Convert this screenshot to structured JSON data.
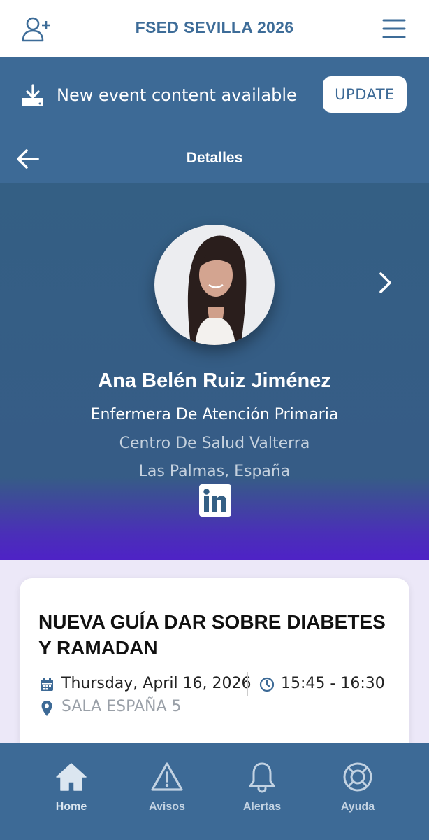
{
  "header": {
    "title": "FSED SEVILLA 2026",
    "add_user_icon": "add-user-icon",
    "menu_icon": "hamburger-menu-icon"
  },
  "banner": {
    "message": "New event content available",
    "update_label": "UPDATE",
    "icon": "download-icon"
  },
  "nav": {
    "title": "Detalles",
    "back_icon": "arrow-left-icon"
  },
  "speaker": {
    "name": "Ana Belén Ruiz Jiménez",
    "role": "Enfermera De Atención Primaria",
    "center": "Centro De Salud Valterra",
    "location": "Las Palmas, España",
    "linkedin_label": "in",
    "next_icon": "chevron-right-icon"
  },
  "session": {
    "title": "NUEVA GUÍA DAR SOBRE DIABETES Y RAMADAN",
    "date": "Thursday, April 16, 2026",
    "time": "15:45 - 16:30",
    "room": "SALA ESPAÑA 5"
  },
  "tabs": [
    {
      "label": "Home",
      "icon": "home-icon"
    },
    {
      "label": "Avisos",
      "icon": "warning-icon"
    },
    {
      "label": "Alertas",
      "icon": "bell-icon"
    },
    {
      "label": "Ayuda",
      "icon": "lifebuoy-icon"
    }
  ],
  "colors": {
    "primary": "#3d6a96",
    "title_blue": "#3d6c98",
    "gradient_end": "#4e22c6",
    "background": "#ece8f8"
  }
}
